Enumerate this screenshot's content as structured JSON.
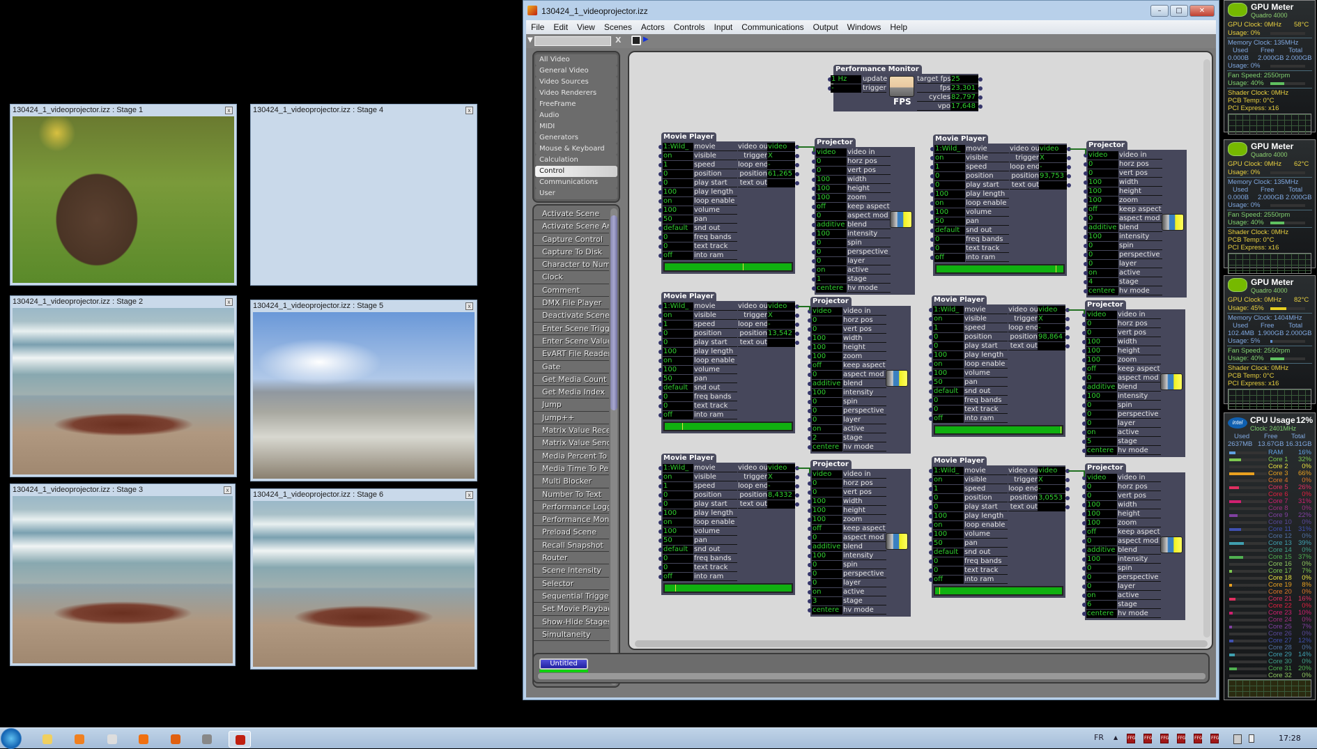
{
  "stages": [
    {
      "title": "130424_1_videoprojector.izz : Stage 1",
      "close": "x"
    },
    {
      "title": "130424_1_videoprojector.izz : Stage 4",
      "close": "x"
    },
    {
      "title": "130424_1_videoprojector.izz : Stage 2",
      "close": "x"
    },
    {
      "title": "130424_1_videoprojector.izz : Stage 5",
      "close": "x"
    },
    {
      "title": "130424_1_videoprojector.izz : Stage 3",
      "close": "x"
    },
    {
      "title": "130424_1_videoprojector.izz : Stage 6",
      "close": "x"
    }
  ],
  "app": {
    "title": "130424_1_videoprojector.izz",
    "window_buttons": {
      "minimize": "–",
      "maximize": "□",
      "close": "✕"
    },
    "menu": [
      "File",
      "Edit",
      "View",
      "Scenes",
      "Actors",
      "Controls",
      "Input",
      "Communications",
      "Output",
      "Windows",
      "Help"
    ],
    "search_value": "",
    "search_clear": "X",
    "categories": [
      "All Video",
      "General Video",
      "Video Sources",
      "Video Renderers",
      "FreeFrame",
      "Audio",
      "MIDI",
      "Generators",
      "Mouse & Keyboard",
      "Calculation",
      "Control",
      "Communications",
      "User"
    ],
    "selected_category": "Control",
    "actors": [
      "Activate Scene",
      "Activate Scene An",
      "Capture Control",
      "Capture To Disk",
      "Character to Num",
      "Clock",
      "Comment",
      "DMX File Player",
      "Deactivate Scene",
      "Enter Scene Trigg",
      "Enter Scene Value",
      "EvART File Reader",
      "Gate",
      "Get Media Count",
      "Get Media Index",
      "Jump",
      "Jump++",
      "Matrix Value Rece",
      "Matrix Value Send",
      "Media Percent To",
      "Media Time To Pe",
      "Multi Blocker",
      "Number To Text",
      "Performance Logg",
      "Performance Moni",
      "Preload Scene",
      "Recall Snapshot",
      "Router",
      "Scene Intensity",
      "Selector",
      "Sequential Trigger",
      "Set Movie Playbac",
      "Show-Hide Stages",
      "Simultaneity"
    ],
    "scene_tab": "Untitled"
  },
  "perf_monitor": {
    "title": "Performance Monitor",
    "inputs": [
      {
        "value": "1 Hz",
        "label": "update"
      },
      {
        "value": "-",
        "label": "trigger"
      }
    ],
    "outputs": [
      {
        "label": "target fps",
        "value": "25"
      },
      {
        "label": "fps",
        "value": "23,301"
      },
      {
        "label": "cycles",
        "value": "82,797"
      },
      {
        "label": "vpo",
        "value": "17,648"
      }
    ],
    "icon_label": "FPS"
  },
  "movie_player_labels": {
    "title": "Movie Player",
    "inputs": [
      "movie",
      "visible",
      "speed",
      "position",
      "play start",
      "play length",
      "loop enable",
      "volume",
      "pan",
      "snd out",
      "freq bands",
      "text track",
      "into ram"
    ],
    "outputs": [
      "video out",
      "trigger",
      "loop end",
      "position",
      "text out"
    ]
  },
  "projector_labels": {
    "title": "Projector",
    "inputs": [
      "video in",
      "horz pos",
      "vert pos",
      "width",
      "height",
      "zoom",
      "keep aspect",
      "aspect mod",
      "blend",
      "intensity",
      "spin",
      "perspective",
      "layer",
      "active",
      "stage",
      "hv mode"
    ]
  },
  "chains": [
    {
      "mp_inputs": [
        "1:Wild_",
        "on",
        "1",
        "0",
        "0",
        "100",
        "on",
        "100",
        "50",
        "default",
        "0",
        "0",
        "off"
      ],
      "mp_outputs": [
        "video",
        "X",
        "-",
        "61,265",
        ""
      ],
      "proj_inputs": [
        "video",
        "0",
        "0",
        "100",
        "100",
        "100",
        "off",
        "0",
        "additive",
        "100",
        "0",
        "0",
        "0",
        "on",
        "1",
        "centere"
      ]
    },
    {
      "mp_inputs": [
        "1:Wild_",
        "on",
        "1",
        "0",
        "0",
        "100",
        "on",
        "100",
        "50",
        "default",
        "0",
        "0",
        "off"
      ],
      "mp_outputs": [
        "video",
        "X",
        "-",
        "93,753",
        ""
      ],
      "proj_inputs": [
        "video",
        "0",
        "0",
        "100",
        "100",
        "100",
        "off",
        "0",
        "additive",
        "100",
        "0",
        "0",
        "0",
        "on",
        "4",
        "centere"
      ]
    },
    {
      "mp_inputs": [
        "1:Wild_",
        "on",
        "1",
        "0",
        "0",
        "100",
        "on",
        "100",
        "50",
        "default",
        "0",
        "0",
        "off"
      ],
      "mp_outputs": [
        "video",
        "X",
        "-",
        "13,542",
        ""
      ],
      "proj_inputs": [
        "video",
        "0",
        "0",
        "100",
        "100",
        "100",
        "off",
        "0",
        "additive",
        "100",
        "0",
        "0",
        "0",
        "on",
        "2",
        "centere"
      ]
    },
    {
      "mp_inputs": [
        "1:Wild_",
        "on",
        "1",
        "0",
        "0",
        "100",
        "on",
        "100",
        "50",
        "default",
        "0",
        "0",
        "off"
      ],
      "mp_outputs": [
        "video",
        "X",
        "-",
        "98,864",
        ""
      ],
      "proj_inputs": [
        "video",
        "0",
        "0",
        "100",
        "100",
        "100",
        "off",
        "0",
        "additive",
        "100",
        "0",
        "0",
        "0",
        "on",
        "5",
        "centere"
      ]
    },
    {
      "mp_inputs": [
        "1:Wild_",
        "on",
        "1",
        "0",
        "0",
        "100",
        "on",
        "100",
        "50",
        "default",
        "0",
        "0",
        "off"
      ],
      "mp_outputs": [
        "video",
        "X",
        "-",
        "8,4332",
        ""
      ],
      "proj_inputs": [
        "video",
        "0",
        "0",
        "100",
        "100",
        "100",
        "off",
        "0",
        "additive",
        "100",
        "0",
        "0",
        "0",
        "on",
        "3",
        "centere"
      ]
    },
    {
      "mp_inputs": [
        "1:Wild_",
        "on",
        "1",
        "0",
        "0",
        "100",
        "on",
        "100",
        "50",
        "default",
        "0",
        "0",
        "off"
      ],
      "mp_outputs": [
        "video",
        "X",
        "-",
        "3,0553",
        ""
      ],
      "proj_inputs": [
        "video",
        "0",
        "0",
        "100",
        "100",
        "100",
        "off",
        "0",
        "additive",
        "100",
        "0",
        "0",
        "0",
        "on",
        "6",
        "centere"
      ]
    }
  ],
  "gpu_meters": [
    {
      "title": "GPU Meter",
      "model": "Quadro 4000",
      "gpu_clock": "GPU Clock: 0MHz",
      "temp": "58°C",
      "usage": "Usage: 0%",
      "usage_pct": 0,
      "mem_clock": "Memory Clock: 135MHz",
      "mem_headers": [
        "Used",
        "Free",
        "Total"
      ],
      "mem_values": [
        "0.000B",
        "2.000GB",
        "2.000GB"
      ],
      "mem_usage": "Usage: 0%",
      "mem_usage_pct": 0,
      "fan": "Fan Speed: 2550rpm",
      "fan_usage": "Usage: 40%",
      "fan_pct": 40,
      "shader": "Shader Clock: 0MHz",
      "pcb": "PCB Temp: 0°C",
      "pci": "PCI Express: x16"
    },
    {
      "title": "GPU Meter",
      "model": "Quadro 4000",
      "gpu_clock": "GPU Clock: 0MHz",
      "temp": "62°C",
      "usage": "Usage: 0%",
      "usage_pct": 0,
      "mem_clock": "Memory Clock: 135MHz",
      "mem_headers": [
        "Used",
        "Free",
        "Total"
      ],
      "mem_values": [
        "0.000B",
        "2.000GB",
        "2.000GB"
      ],
      "mem_usage": "Usage: 0%",
      "mem_usage_pct": 0,
      "fan": "Fan Speed: 2550rpm",
      "fan_usage": "Usage: 40%",
      "fan_pct": 40,
      "shader": "Shader Clock: 0MHz",
      "pcb": "PCB Temp: 0°C",
      "pci": "PCI Express: x16"
    },
    {
      "title": "GPU Meter",
      "model": "Quadro 4000",
      "gpu_clock": "GPU Clock: 0MHz",
      "temp": "82°C",
      "usage": "Usage: 45%",
      "usage_pct": 45,
      "mem_clock": "Memory Clock: 1404MHz",
      "mem_headers": [
        "Used",
        "Free",
        "Total"
      ],
      "mem_values": [
        "102.4MB",
        "1.900GB",
        "2.000GB"
      ],
      "mem_usage": "Usage: 5%",
      "mem_usage_pct": 5,
      "fan": "Fan Speed: 2550rpm",
      "fan_usage": "Usage: 40%",
      "fan_pct": 40,
      "shader": "Shader Clock: 0MHz",
      "pcb": "PCB Temp: 0°C",
      "pci": "PCI Express: x16"
    }
  ],
  "cpu_meter": {
    "title": "CPU Usage",
    "total": "12%",
    "clock": "Clock: 2401MHz",
    "logo": "intel",
    "mem_headers": [
      "Used",
      "Free",
      "Total"
    ],
    "mem_values": [
      "2637MB",
      "13.67GB",
      "16.31GB"
    ],
    "ram": {
      "label": "RAM",
      "pct": 16,
      "color": "#60a0e0"
    },
    "cores": [
      32,
      0,
      66,
      0,
      26,
      0,
      31,
      0,
      22,
      0,
      31,
      0,
      39,
      0,
      37,
      0,
      7,
      0,
      8,
      0,
      16,
      0,
      10,
      0,
      7,
      0,
      12,
      0,
      14,
      0,
      20,
      0
    ],
    "core_label": "Core",
    "palette": [
      "#7ec850",
      "#e8e040",
      "#e8a020",
      "#e07828",
      "#e03060",
      "#e02040",
      "#d02070",
      "#a03080",
      "#8040a0",
      "#584898",
      "#4050b0",
      "#5070a0",
      "#40a0b0",
      "#40a088",
      "#50b050",
      "#90c860"
    ]
  },
  "taskbar": {
    "language": "FR",
    "tray_arrow": "▲",
    "clock": "17:28",
    "pinned": [
      "explorer",
      "media-player",
      "media-center",
      "vlc",
      "firefox",
      "tool",
      "isadora"
    ],
    "tray_icons": [
      "FFG",
      "FFG",
      "FFG",
      "FFG",
      "FFG",
      "FFG"
    ]
  }
}
